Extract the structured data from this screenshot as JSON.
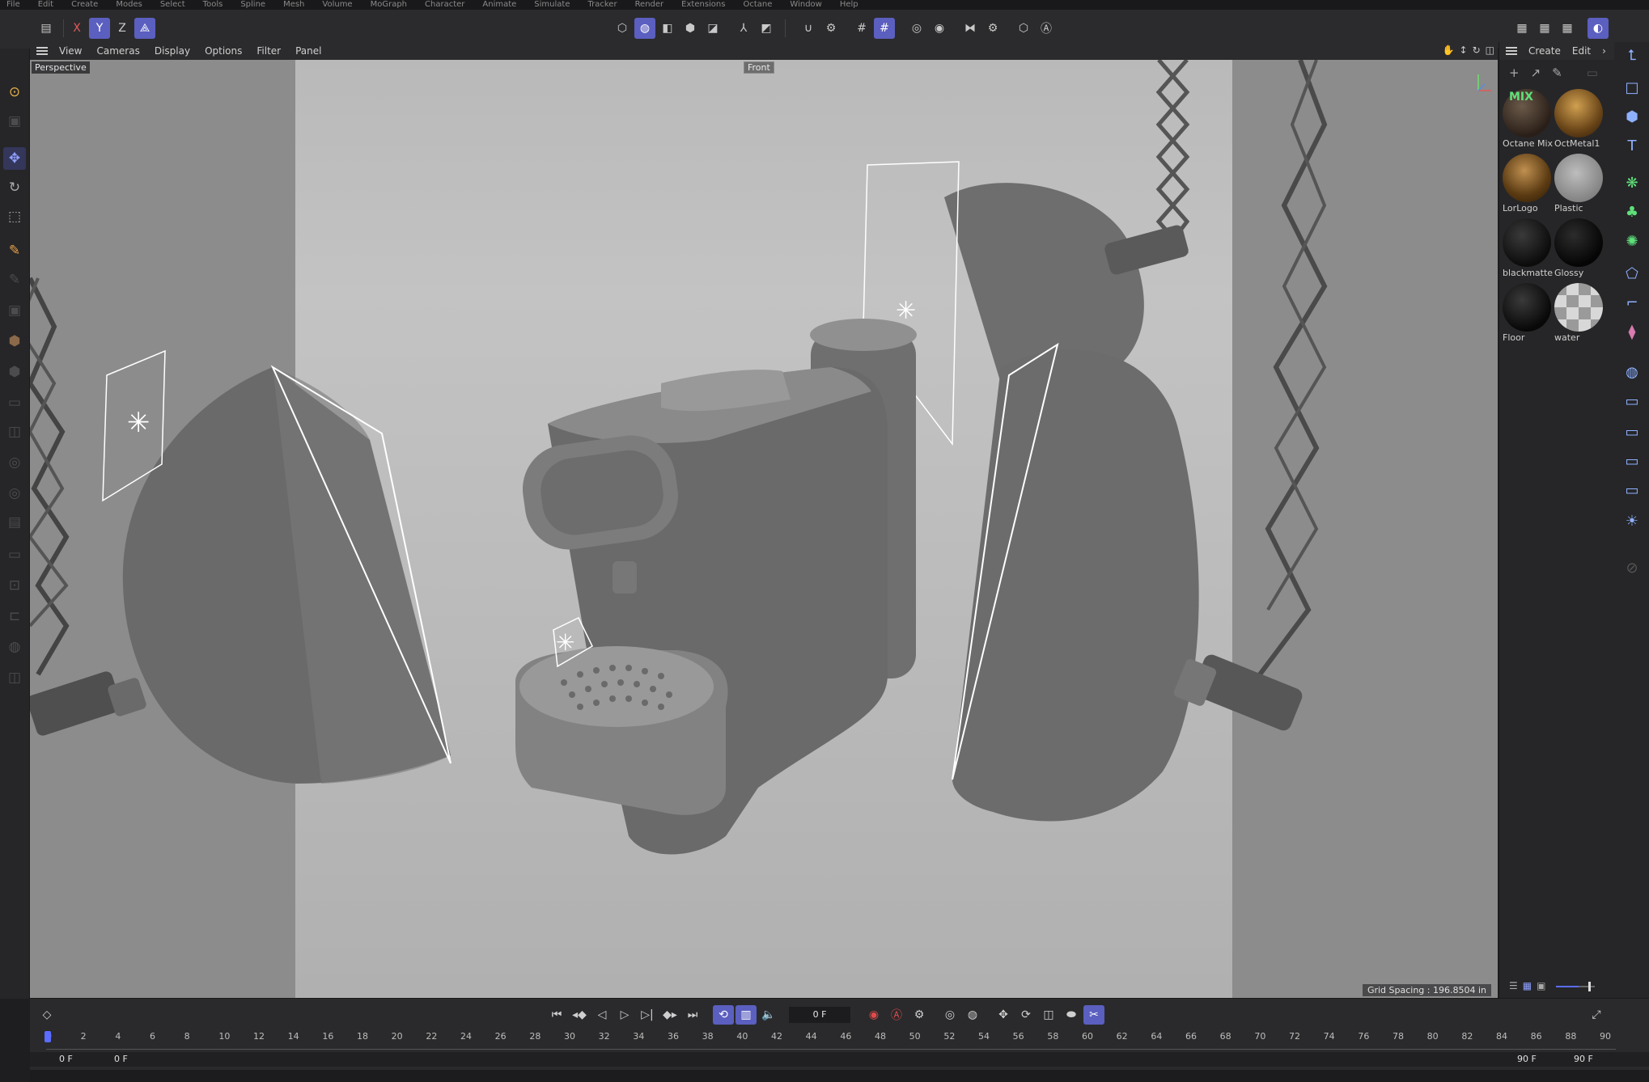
{
  "menu": [
    "File",
    "Edit",
    "Create",
    "Modes",
    "Select",
    "Tools",
    "Spline",
    "Mesh",
    "Volume",
    "MoGraph",
    "Character",
    "Animate",
    "Simulate",
    "Tracker",
    "Render",
    "Extensions",
    "Octane",
    "Window",
    "Help"
  ],
  "toolbar": {
    "axis_x": "X",
    "axis_y": "Y",
    "axis_z": "Z"
  },
  "viewport": {
    "menu": [
      "View",
      "Cameras",
      "Display",
      "Options",
      "Filter",
      "Panel"
    ],
    "camera_label": "Perspective",
    "view_label": "Front",
    "grid_spacing": "Grid Spacing : 196.8504 in"
  },
  "material_panel": {
    "menu": [
      "Create",
      "Edit"
    ],
    "materials": [
      {
        "name": "Octane Mix",
        "color": "#3a2a22"
      },
      {
        "name": "OctMetal1",
        "color": "#7a5420"
      },
      {
        "name": "LorLogo",
        "color": "#6b4a1e"
      },
      {
        "name": "Plastic",
        "color": "#9a9a9a"
      },
      {
        "name": "blackmatte",
        "color": "#141414"
      },
      {
        "name": "Glossy",
        "color": "#0e0e0e"
      },
      {
        "name": "Floor",
        "color": "#101010"
      },
      {
        "name": "water",
        "color": "#b6b6b6"
      }
    ],
    "mix_text": "MIX"
  },
  "timeline": {
    "current_frame": "0 F",
    "ticks": [
      "0",
      "2",
      "4",
      "6",
      "8",
      "10",
      "12",
      "14",
      "16",
      "18",
      "20",
      "22",
      "24",
      "26",
      "28",
      "30",
      "32",
      "34",
      "36",
      "38",
      "40",
      "42",
      "44",
      "46",
      "48",
      "50",
      "52",
      "54",
      "56",
      "58",
      "60",
      "62",
      "64",
      "66",
      "68",
      "70",
      "72",
      "74",
      "76",
      "78",
      "80",
      "82",
      "84",
      "86",
      "88",
      "90"
    ],
    "range_start": "0 F",
    "range_start2": "0 F",
    "range_end": "90 F",
    "range_end2": "90 F"
  },
  "colors": {
    "accent": "#5b5fbf",
    "viewport_bg": "#bdbdbd"
  }
}
